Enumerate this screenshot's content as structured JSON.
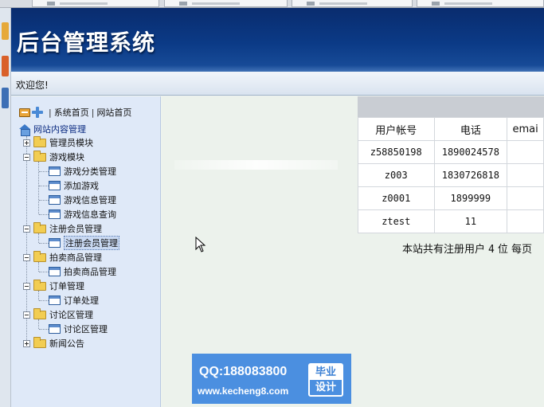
{
  "header": {
    "title": "后台管理系统"
  },
  "welcome": {
    "text": "欢迎您!"
  },
  "sidebar": {
    "toolbar": {
      "system_home": "系统首页",
      "site_home": "网站首页",
      "separator": "|"
    },
    "root": {
      "label": "网站内容管理"
    },
    "tree": [
      {
        "label": "管理员模块",
        "children": []
      },
      {
        "label": "游戏模块",
        "children": [
          "游戏分类管理",
          "添加游戏",
          "游戏信息管理",
          "游戏信息查询"
        ]
      },
      {
        "label": "注册会员管理",
        "children": [
          "注册会员管理"
        ]
      },
      {
        "label": "拍卖商品管理",
        "children": [
          "拍卖商品管理"
        ]
      },
      {
        "label": "订单管理",
        "children": [
          "订单处理"
        ]
      },
      {
        "label": "讨论区管理",
        "children": [
          "讨论区管理"
        ]
      },
      {
        "label": "新闻公告",
        "children": []
      }
    ]
  },
  "main": {
    "table": {
      "headers": [
        "用户帐号",
        "电话",
        "emai"
      ],
      "rows": [
        [
          "z58850198",
          "1890024578",
          ""
        ],
        [
          "z003",
          "1830726818",
          ""
        ],
        [
          "z0001",
          "1899999",
          ""
        ],
        [
          "ztest",
          "11",
          ""
        ]
      ]
    },
    "summary": {
      "prefix": "本站共有注册用户",
      "count": "4",
      "suffix": "位  每页"
    }
  },
  "watermark": {
    "qq": "QQ:188083800",
    "url": "www.kecheng8.com",
    "badge_top": "毕业",
    "badge_bottom": "设计"
  },
  "colors": {
    "header_bg": "#0b3a86",
    "sidebar_bg": "#dfe9f8",
    "watermark_bg": "#4b8fe0"
  }
}
